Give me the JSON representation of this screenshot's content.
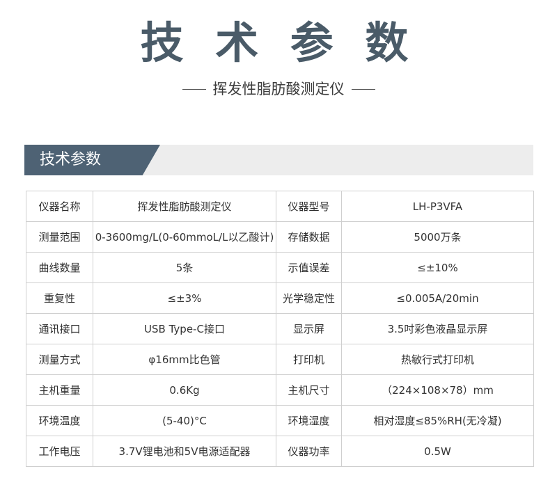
{
  "header": {
    "title": "技 术 参 数",
    "subtitle": "挥发性脂肪酸测定仪"
  },
  "section": {
    "title": "技术参数"
  },
  "colors": {
    "title": "#4a5b68",
    "tab": "#4e6274",
    "band": "#ededed",
    "border": "#cfcfcf"
  },
  "table": {
    "rows": [
      [
        "仪器名称",
        "挥发性脂肪酸测定仪",
        "仪器型号",
        "LH-P3VFA"
      ],
      [
        "测量范围",
        "0-3600mg/L(0-60mmoL/L以乙酸计)",
        "存储数据",
        "5000万条"
      ],
      [
        "曲线数量",
        "5条",
        "示值误差",
        "≤±10%"
      ],
      [
        "重复性",
        "≤±3%",
        "光学稳定性",
        "≤0.005A/20min"
      ],
      [
        "通讯接口",
        "USB Type-C接口",
        "显示屏",
        "3.5吋彩色液晶显示屏"
      ],
      [
        "测量方式",
        "φ16mm比色管",
        "打印机",
        "热敏行式打印机"
      ],
      [
        "主机重量",
        "0.6Kg",
        "主机尺寸",
        "（224×108×78）mm"
      ],
      [
        "环境温度",
        "(5-40)°C",
        "环境湿度",
        "相对湿度≤85%RH(无冷凝)"
      ],
      [
        "工作电压",
        "3.7V锂电池和5V电源适配器",
        "仪器功率",
        "0.5W"
      ]
    ]
  }
}
